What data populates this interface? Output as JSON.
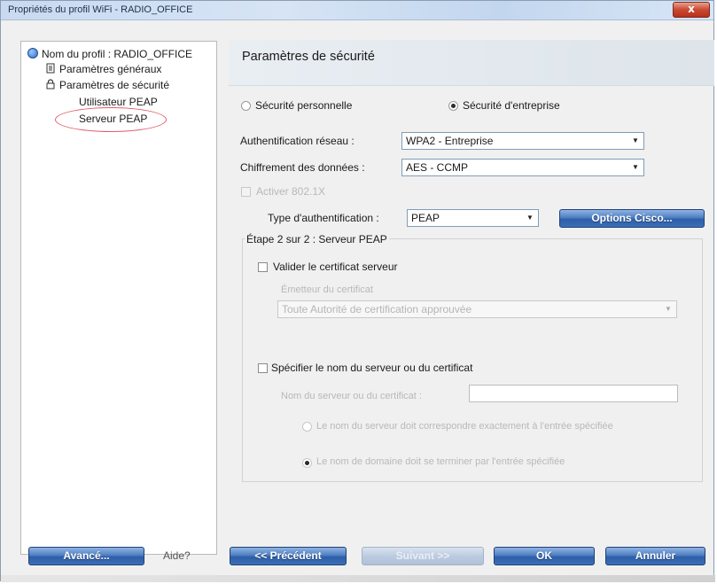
{
  "window": {
    "title": "Propriétés du profil WiFi - RADIO_OFFICE",
    "close_label": "x"
  },
  "tree": {
    "root": "Nom du profil : RADIO_OFFICE",
    "general": "Paramètres généraux",
    "security": "Paramètres de sécurité",
    "peap_user": "Utilisateur PEAP",
    "peap_server": "Serveur PEAP",
    "selected": "Serveur PEAP"
  },
  "section": {
    "title": "Paramètres de sécurité"
  },
  "security_mode": {
    "personal_label": "Sécurité personnelle",
    "enterprise_label": "Sécurité d'entreprise",
    "selected": "Sécurité d'entreprise"
  },
  "auth": {
    "network_label": "Authentification réseau :",
    "network_value": "WPA2 - Entreprise",
    "encryption_label": "Chiffrement des données :",
    "encryption_value": "AES - CCMP",
    "8021x_label": "Activer 802.1X",
    "type_label": "Type d'authentification :",
    "type_value": "PEAP",
    "cisco_button": "Options Cisco..."
  },
  "step": {
    "legend": "Étape 2 sur 2 : Serveur PEAP",
    "validate_cert_label": "Valider le certificat serveur",
    "cert_issuer_label": "Émetteur du certificat",
    "cert_issuer_value": "Toute Autorité de certification approuvée",
    "specify_server_label": "Spécifier le nom du serveur ou du certificat",
    "server_name_label": "Nom du serveur ou du certificat :",
    "server_name_value": "",
    "option_exact_label": "Le nom du serveur doit correspondre exactement à l'entrée spécifiée",
    "option_domain_label": "Le nom de domaine doit se terminer par l'entrée spécifiée"
  },
  "footer": {
    "advanced_button": "Avancé...",
    "help_label": "Aide?",
    "previous_button": "<< Précédent",
    "next_button": "Suivant >>",
    "ok_button": "OK",
    "cancel_button": "Annuler"
  },
  "colors": {
    "button_blue": "#3d6fb8",
    "selection_ellipse": "#e25a6a",
    "window_bg": "#f0f0f0"
  }
}
